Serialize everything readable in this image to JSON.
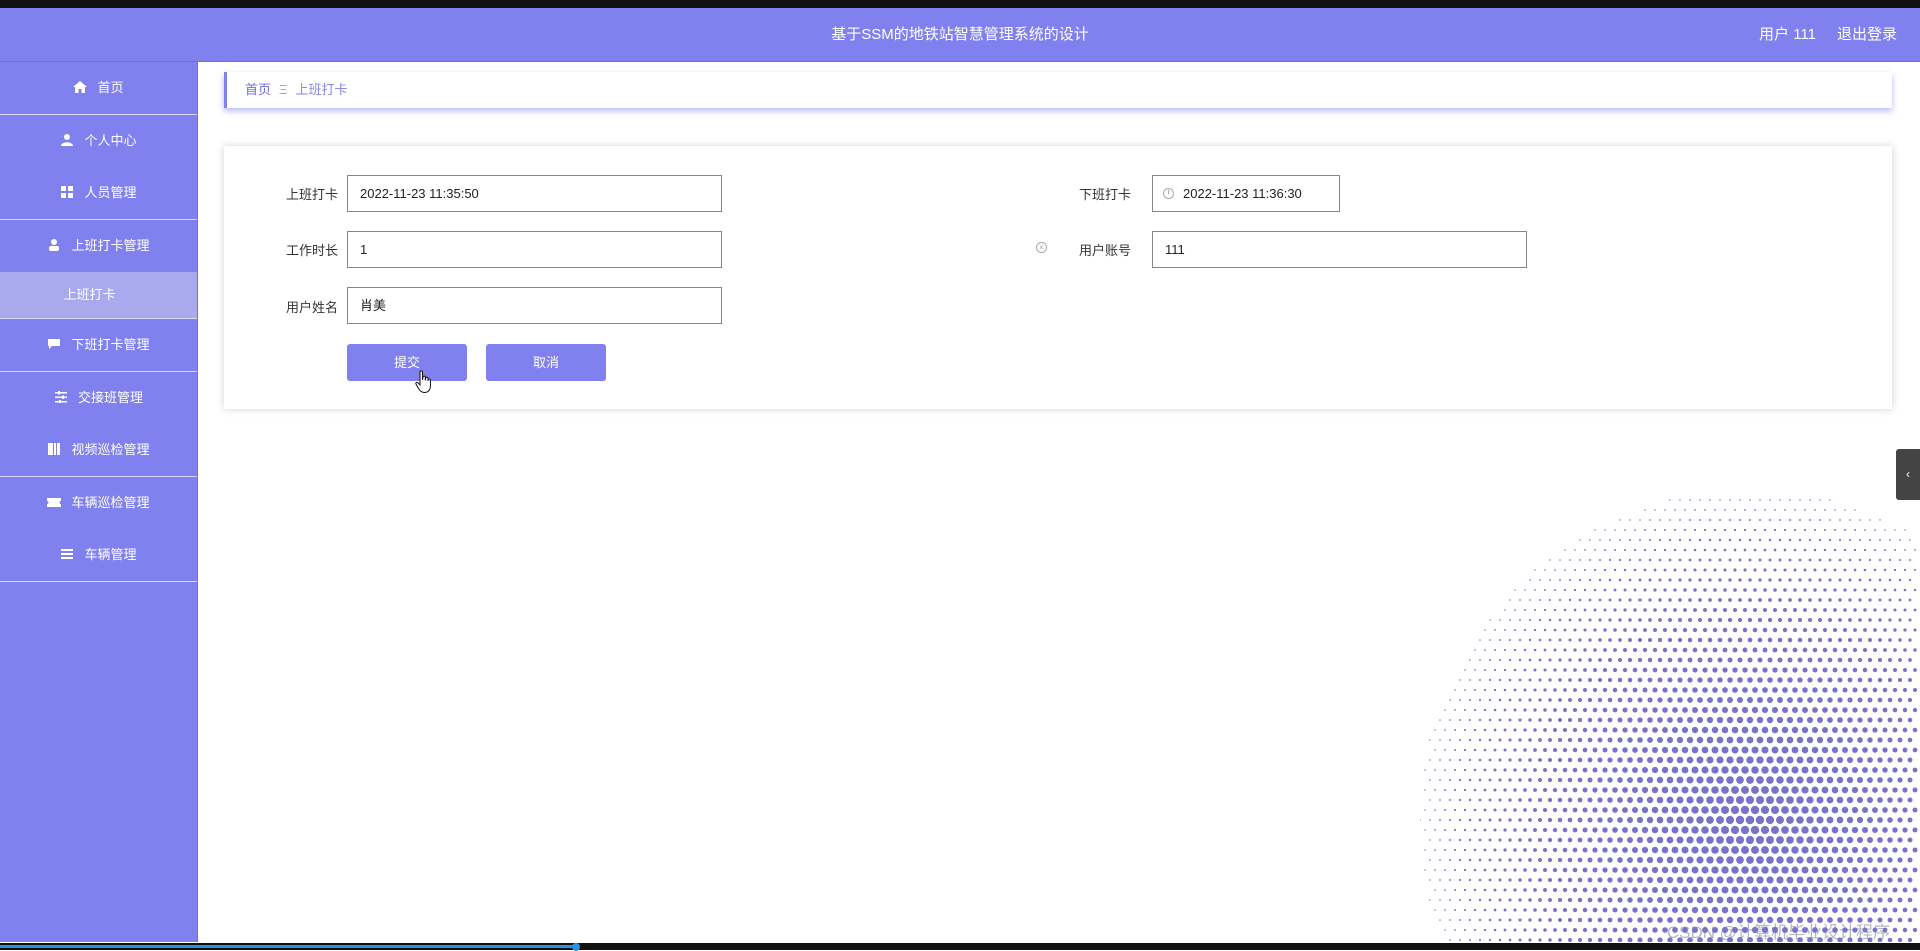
{
  "header": {
    "title": "基于SSM的地铁站智慧管理系统的设计",
    "user_label": "用户 111",
    "logout_label": "退出登录"
  },
  "sidebar": {
    "items": [
      {
        "label": "首页",
        "icon": "home-icon"
      },
      {
        "label": "个人中心",
        "icon": "user-icon"
      },
      {
        "label": "人员管理",
        "icon": "grid-icon"
      },
      {
        "label": "上班打卡管理",
        "icon": "person-icon"
      },
      {
        "label": "上班打卡",
        "icon": ""
      },
      {
        "label": "下班打卡管理",
        "icon": "chat-icon"
      },
      {
        "label": "交接班管理",
        "icon": "sliders-icon"
      },
      {
        "label": "视频巡检管理",
        "icon": "book-icon"
      },
      {
        "label": "车辆巡检管理",
        "icon": "ticket-icon"
      },
      {
        "label": "车辆管理",
        "icon": "list-icon"
      }
    ]
  },
  "breadcrumb": {
    "home": "首页",
    "separator": "Ξ",
    "current": "上班打卡"
  },
  "form": {
    "checkin": {
      "label": "上班打卡",
      "value": "2022-11-23 11:35:50"
    },
    "checkout": {
      "label": "下班打卡",
      "value": "2022-11-23 11:36:30"
    },
    "duration": {
      "label": "工作时长",
      "value": "1"
    },
    "account": {
      "label": "用户账号",
      "value": "111"
    },
    "name": {
      "label": "用户姓名",
      "value": "肖美"
    },
    "submit_label": "提交",
    "cancel_label": "取消"
  },
  "watermark": "CSDN @计算机毕业设计程序",
  "colors": {
    "primary": "#8080ef",
    "submenu_active": "#a9a9ee"
  }
}
